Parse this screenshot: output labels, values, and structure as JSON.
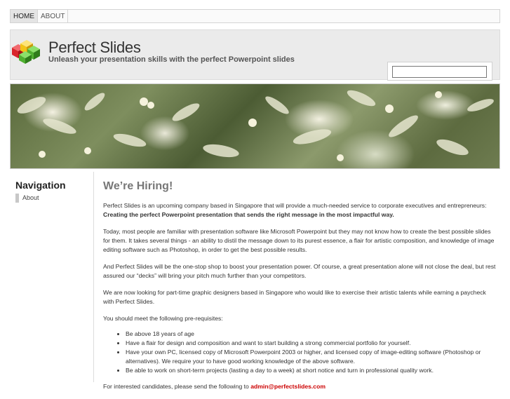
{
  "nav": {
    "items": [
      {
        "label": "HOME",
        "active": true
      },
      {
        "label": "ABOUT",
        "active": false
      }
    ]
  },
  "header": {
    "title": "Perfect Slides",
    "tagline": "Unleash your presentation skills with the perfect Powerpoint slides",
    "search_placeholder": ""
  },
  "sidebar": {
    "title": "Navigation",
    "items": [
      {
        "label": "About"
      }
    ]
  },
  "main": {
    "heading": "We’re Hiring!",
    "p1_text": "Perfect Slides is an upcoming company based in Singapore that will provide a much-needed service to corporate executives and entrepreneurs: ",
    "p1_bold": "Creating the perfect Powerpoint presentation that sends the right message in the most impactful way.",
    "p2": "Today, most people are familiar with presentation software like Microsoft Powerpoint but they may not know how to create the best possible slides for them. It takes several things - an ability to distil the message down to its purest essence, a flair for artistic composition, and knowledge of image editing software such as Photoshop, in order to get the best possible results.",
    "p3": "And Perfect Slides will be the one-stop shop to boost your presentation power. Of course, a great presentation alone will not close the deal, but rest assured our “decks” will bring your pitch much further than your competitors.",
    "p4": "We are now looking for part-time graphic designers based in Singapore who would like to exercise their artistic talents while earning a paycheck with Perfect Slides.",
    "p5": "You should meet the following pre-requisites:",
    "requirements": [
      "Be above 18 years of age",
      "Have a flair for design and composition and want to start building a strong commercial portfolio for yourself.",
      "Have your own PC, licensed copy of Microsoft Powerpoint 2003 or higher, and licensed copy of image-editing software (Photoshop or alternatives). We require your to have good working knowledge of the above software.",
      "Be able to work on short-term projects (lasting a day to a week) at short notice and turn in professional quality work."
    ],
    "p6_text": "For interested candidates, please send the following to ",
    "email": "admin@perfectslides.com"
  },
  "colors": {
    "logo_red": "#d9262c",
    "logo_green": "#4fb030",
    "logo_yellow": "#f2c318",
    "email_link": "#cc0000"
  }
}
